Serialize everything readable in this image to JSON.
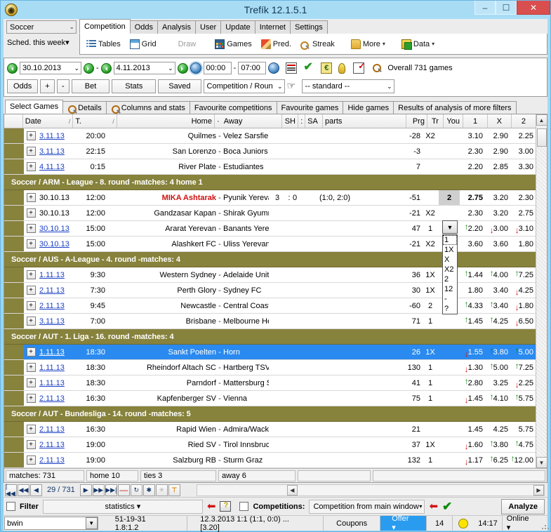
{
  "window": {
    "title": "Trefík 12.1.5.1",
    "app_icon": "app-logo-icon",
    "minimize": "–",
    "maximize": "☐",
    "close": "✕"
  },
  "topbar": {
    "sport_combo": {
      "value": "Soccer",
      "arrow": "⌄"
    },
    "schedule_combo": {
      "value": "Sched. this week",
      "arrow": "▾"
    },
    "tabs": [
      {
        "label": "Competition",
        "active": true
      },
      {
        "label": "Odds",
        "active": false
      },
      {
        "label": "Analysis",
        "active": false
      },
      {
        "label": "User",
        "active": false
      },
      {
        "label": "Update",
        "active": false
      },
      {
        "label": "Internet",
        "active": false
      },
      {
        "label": "Settings",
        "active": false
      }
    ]
  },
  "ribbon": {
    "items": [
      {
        "label": "Tables",
        "icon": "tables-icon",
        "disabled": false,
        "caret": ""
      },
      {
        "label": "Grid",
        "icon": "grid-icon",
        "disabled": false,
        "caret": ""
      },
      {
        "label": "Draw",
        "icon": "",
        "disabled": true,
        "caret": ""
      },
      {
        "label": "Games",
        "icon": "games-icon",
        "disabled": false,
        "caret": ""
      },
      {
        "label": "Pred.",
        "icon": "pencil-icon",
        "disabled": false,
        "caret": ""
      },
      {
        "label": "Streak",
        "icon": "magnifier-plus-icon",
        "disabled": false,
        "caret": ""
      },
      {
        "label": "More",
        "icon": "folder-icon",
        "disabled": false,
        "caret": "▾"
      },
      {
        "label": "Data",
        "icon": "database-add-icon",
        "disabled": false,
        "caret": "▾"
      }
    ]
  },
  "daterow": {
    "date_from": "30.10.2013",
    "date_to": "4.11.2013",
    "time_from": "00:00",
    "time_sep": "-",
    "time_to": "07:00",
    "dash": "-",
    "overall": "Overall 731 games",
    "icons": [
      "calendar-icon",
      "check-icon",
      "euro-icon",
      "bulb-icon",
      "form-check-icon",
      "magnifier-plus-icon"
    ]
  },
  "buttonrow": {
    "buttons": [
      "Odds",
      "+",
      "-",
      "Bet",
      "Stats",
      "Saved"
    ],
    "group_combo": "Competition / Roun",
    "hand_icon": "pointing-hand-icon",
    "standard_combo": "-- standard --",
    "arrow": "⌄"
  },
  "subtabs": [
    {
      "label": "Select Games",
      "active": true,
      "icon": ""
    },
    {
      "label": "Details",
      "active": false,
      "icon": "magnifier-icon"
    },
    {
      "label": "Columns and stats",
      "active": false,
      "icon": "magnifier-icon"
    },
    {
      "label": "Favourite competitions",
      "active": false,
      "icon": ""
    },
    {
      "label": "Favourite games",
      "active": false,
      "icon": ""
    },
    {
      "label": "Hide games",
      "active": false,
      "icon": ""
    },
    {
      "label": "Results of analysis of more filters",
      "active": false,
      "icon": ""
    }
  ],
  "grid": {
    "columns": [
      {
        "key": "expand",
        "label": ""
      },
      {
        "key": "date",
        "label": "Date",
        "sort": "/"
      },
      {
        "key": "time",
        "label": "T.",
        "sort": "/"
      },
      {
        "key": "home",
        "label": "Home"
      },
      {
        "key": "dash",
        "label": "·"
      },
      {
        "key": "away",
        "label": "Away"
      },
      {
        "key": "sh",
        "label": "SH"
      },
      {
        "key": "colon",
        "label": ":"
      },
      {
        "key": "sa",
        "label": "SA"
      },
      {
        "key": "parts",
        "label": "parts"
      },
      {
        "key": "prg",
        "label": "Prg"
      },
      {
        "key": "tr",
        "label": "Tr"
      },
      {
        "key": "you",
        "label": "You"
      },
      {
        "key": "o1",
        "label": "1"
      },
      {
        "key": "oX",
        "label": "X"
      },
      {
        "key": "o2",
        "label": "2"
      }
    ],
    "rows": [
      {
        "type": "match",
        "date": "3.11.13",
        "date_link": true,
        "time": "20:00",
        "home": "Quilmes",
        "away": "Velez Sarsfield",
        "sh": "",
        "sa": "",
        "parts": "",
        "prg": "-28",
        "tr": "X2",
        "you": "",
        "o1": "3.10",
        "oX": "2.90",
        "o2": "2.25",
        "a1": "",
        "aX": "",
        "a2": "",
        "selected": false,
        "home_red": false,
        "o1_bold": false
      },
      {
        "type": "match",
        "date": "3.11.13",
        "date_link": true,
        "time": "22:15",
        "home": "San Lorenzo",
        "away": "Boca Juniors",
        "sh": "",
        "sa": "",
        "parts": "",
        "prg": "-3",
        "tr": "",
        "you": "",
        "o1": "2.30",
        "oX": "2.90",
        "o2": "3.00",
        "a1": "",
        "aX": "",
        "a2": "",
        "selected": false,
        "home_red": false,
        "o1_bold": false
      },
      {
        "type": "match",
        "date": "4.11.13",
        "date_link": true,
        "time": "0:15",
        "home": "River Plate",
        "away": "Estudiantes",
        "sh": "",
        "sa": "",
        "parts": "",
        "prg": "7",
        "tr": "",
        "you": "",
        "o1": "2.20",
        "oX": "2.85",
        "o2": "3.30",
        "a1": "",
        "aX": "",
        "a2": "",
        "selected": false,
        "home_red": false,
        "o1_bold": false
      },
      {
        "type": "group",
        "label": "Soccer / ARM - League - 8. round -matches: 4  home 1"
      },
      {
        "type": "match",
        "date": "30.10.13",
        "date_link": false,
        "time": "12:00",
        "home": "MIKA Ashtarak",
        "away": "Pyunik Yerevan",
        "sh": "3",
        "sa": "0",
        "parts": "(1:0, 2:0)",
        "prg": "-51",
        "tr": "",
        "you": "2",
        "o1": "2.75",
        "oX": "3.20",
        "o2": "2.30",
        "a1": "",
        "aX": "",
        "a2": "",
        "selected": false,
        "home_red": true,
        "o1_bold": true
      },
      {
        "type": "match",
        "date": "30.10.13",
        "date_link": false,
        "time": "12:00",
        "home": "Gandzasar Kapan",
        "away": "Shirak Gyumri",
        "sh": "",
        "sa": "",
        "parts": "",
        "prg": "-21",
        "tr": "X2",
        "you": "",
        "o1": "2.30",
        "oX": "3.20",
        "o2": "2.75",
        "a1": "",
        "aX": "",
        "a2": "",
        "selected": false,
        "home_red": false,
        "o1_bold": false
      },
      {
        "type": "match",
        "date": "30.10.13",
        "date_link": true,
        "time": "15:00",
        "home": "Ararat Yerevan",
        "away": "Banants Yerevan",
        "sh": "",
        "sa": "",
        "parts": "",
        "prg": "47",
        "tr": "1",
        "you": "",
        "o1": "2.20",
        "oX": "3.00",
        "o2": "3.10",
        "a1": "up",
        "aX": "down",
        "a2": "down",
        "selected": false,
        "home_red": false,
        "o1_bold": false
      },
      {
        "type": "match",
        "date": "30.10.13",
        "date_link": true,
        "time": "15:00",
        "home": "Alashkert FC",
        "away": "Uliss Yerevan",
        "sh": "",
        "sa": "",
        "parts": "",
        "prg": "-21",
        "tr": "X2",
        "you": "",
        "o1": "3.60",
        "oX": "3.60",
        "o2": "1.80",
        "a1": "",
        "aX": "",
        "a2": "",
        "selected": false,
        "home_red": false,
        "o1_bold": false
      },
      {
        "type": "group",
        "label": "Soccer / AUS - A-League - 4. round -matches: 4"
      },
      {
        "type": "match",
        "date": "1.11.13",
        "date_link": true,
        "time": "9:30",
        "home": "Western Sydney",
        "away": "Adelaide United",
        "sh": "",
        "sa": "",
        "parts": "",
        "prg": "36",
        "tr": "1X",
        "you": "",
        "o1": "1.44",
        "oX": "4.00",
        "o2": "7.25",
        "a1": "up",
        "aX": "up",
        "a2": "up",
        "selected": false,
        "home_red": false,
        "o1_bold": false
      },
      {
        "type": "match",
        "date": "2.11.13",
        "date_link": true,
        "time": "7:30",
        "home": "Perth Glory",
        "away": "Sydney FC",
        "sh": "",
        "sa": "",
        "parts": "",
        "prg": "30",
        "tr": "1X",
        "you": "",
        "o1": "1.80",
        "oX": "3.40",
        "o2": "4.25",
        "a1": "",
        "aX": "",
        "a2": "down",
        "selected": false,
        "home_red": false,
        "o1_bold": false
      },
      {
        "type": "match",
        "date": "2.11.13",
        "date_link": true,
        "time": "9:45",
        "home": "Newcastle",
        "away": "Central Coast Mariners",
        "sh": "",
        "sa": "",
        "parts": "",
        "prg": "-60",
        "tr": "2",
        "you": "",
        "o1": "4.33",
        "oX": "3.40",
        "o2": "1.80",
        "a1": "up",
        "aX": "up",
        "a2": "down",
        "selected": false,
        "home_red": false,
        "o1_bold": false
      },
      {
        "type": "match",
        "date": "3.11.13",
        "date_link": true,
        "time": "7:00",
        "home": "Brisbane",
        "away": "Melbourne Heart",
        "sh": "",
        "sa": "",
        "parts": "",
        "prg": "71",
        "tr": "1",
        "you": "",
        "o1": "1.45",
        "oX": "4.25",
        "o2": "6.50",
        "a1": "up",
        "aX": "up",
        "a2": "down",
        "selected": false,
        "home_red": false,
        "o1_bold": false
      },
      {
        "type": "group",
        "label": "Soccer / AUT - 1. Liga - 16. round -matches: 4"
      },
      {
        "type": "match",
        "date": "1.11.13",
        "date_link": true,
        "time": "18:30",
        "home": "Sankt Poelten",
        "away": "Horn",
        "sh": "",
        "sa": "",
        "parts": "",
        "prg": "26",
        "tr": "1X",
        "you": "",
        "o1": "1.55",
        "oX": "3.80",
        "o2": "5.00",
        "a1": "down",
        "aX": "up",
        "a2": "up",
        "selected": true,
        "home_red": false,
        "o1_bold": false
      },
      {
        "type": "match",
        "date": "1.11.13",
        "date_link": true,
        "time": "18:30",
        "home": "Rheindorf Altach SC",
        "away": "Hartberg TSV",
        "sh": "",
        "sa": "",
        "parts": "",
        "prg": "130",
        "tr": "1",
        "you": "",
        "o1": "1.30",
        "oX": "5.00",
        "o2": "7.25",
        "a1": "down",
        "aX": "up",
        "a2": "up",
        "selected": false,
        "home_red": false,
        "o1_bold": false
      },
      {
        "type": "match",
        "date": "1.11.13",
        "date_link": true,
        "time": "18:30",
        "home": "Parndorf",
        "away": "Mattersburg SV",
        "sh": "",
        "sa": "",
        "parts": "",
        "prg": "41",
        "tr": "1",
        "you": "",
        "o1": "2.80",
        "oX": "3.25",
        "o2": "2.25",
        "a1": "up",
        "aX": "",
        "a2": "down",
        "selected": false,
        "home_red": false,
        "o1_bold": false
      },
      {
        "type": "match",
        "date": "2.11.13",
        "date_link": true,
        "time": "16:30",
        "home": "Kapfenberger SV",
        "away": "Vienna",
        "sh": "",
        "sa": "",
        "parts": "",
        "prg": "75",
        "tr": "1",
        "you": "",
        "o1": "1.45",
        "oX": "4.10",
        "o2": "5.75",
        "a1": "down",
        "aX": "up",
        "a2": "up",
        "selected": false,
        "home_red": false,
        "o1_bold": false
      },
      {
        "type": "group",
        "label": "Soccer / AUT - Bundesliga - 14. round -matches: 5"
      },
      {
        "type": "match",
        "date": "2.11.13",
        "date_link": true,
        "time": "16:30",
        "home": "Rapid Wien",
        "away": "Admira/Wacker Mödling",
        "sh": "",
        "sa": "",
        "parts": "",
        "prg": "21",
        "tr": "",
        "you": "",
        "o1": "1.45",
        "oX": "4.25",
        "o2": "5.75",
        "a1": "",
        "aX": "",
        "a2": "",
        "selected": false,
        "home_red": false,
        "o1_bold": false
      },
      {
        "type": "match",
        "date": "2.11.13",
        "date_link": true,
        "time": "19:00",
        "home": "Ried SV",
        "away": "Tirol Innsbruck",
        "sh": "",
        "sa": "",
        "parts": "",
        "prg": "37",
        "tr": "1X",
        "you": "",
        "o1": "1.60",
        "oX": "3.80",
        "o2": "4.75",
        "a1": "down",
        "aX": "up",
        "a2": "up",
        "selected": false,
        "home_red": false,
        "o1_bold": false
      },
      {
        "type": "match",
        "date": "2.11.13",
        "date_link": true,
        "time": "19:00",
        "home": "Salzburg RB",
        "away": "Sturm Graz",
        "sh": "",
        "sa": "",
        "parts": "",
        "prg": "132",
        "tr": "1",
        "you": "",
        "o1": "1.17",
        "oX": "6.25",
        "o2": "12.00",
        "a1": "down",
        "aX": "up",
        "a2": "up",
        "selected": false,
        "home_red": false,
        "o1_bold": false
      }
    ],
    "tip_dropdown": {
      "open": true,
      "selected": "",
      "options": [
        "1",
        "1X",
        "X",
        "X2",
        "2",
        "12",
        "-",
        "?"
      ]
    }
  },
  "summary": {
    "cells": [
      "matches: 731",
      "home 10",
      "ties 3",
      "away 6",
      "",
      ""
    ]
  },
  "navbar": {
    "first": "|◀◀",
    "prev_page": "◀◀",
    "prev": "◀",
    "position": "29 / 731",
    "next": "▶",
    "next_page": "▶▶",
    "last": "▶▶|",
    "delete": "—",
    "refresh": "↻",
    "new": "✱",
    "new_alt": "✳",
    "filter": "⊤"
  },
  "filterbar": {
    "filter_label": "Filter",
    "filter_checked": false,
    "statistics": "statistics ▾",
    "back_arrow": "left-arrow-icon",
    "help_icon": "help-book-icon",
    "competitions_label": "Competitions:",
    "competitions_checked": false,
    "competition_source": "Competition from main window",
    "competition_arrow": "▾",
    "back_arrow2": "left-arrow-icon",
    "confirm": "✔",
    "analyze": "Analyze"
  },
  "statusbar": {
    "bookmaker": "bwin",
    "bookmaker_arrow": "▼",
    "record": "51-19-31  1.8:1.2",
    "lastmatch": "12.3.2013 1:1 (1:1, 0:0) ... [3.20]",
    "coupons": "Coupons",
    "offer": "Offer ▾",
    "count": "14",
    "status_dot": "yellow-status-icon",
    "time": "14:17",
    "online": "Online ▾"
  },
  "colors": {
    "group_header": "#87823c",
    "selection": "#2a8aef",
    "title_bar": "#a8dcf5",
    "accent_blue": "#2a9cf0",
    "up_arrow": "#0a8a0a",
    "down_arrow": "#d01010",
    "home_highlight": "#d01010"
  }
}
